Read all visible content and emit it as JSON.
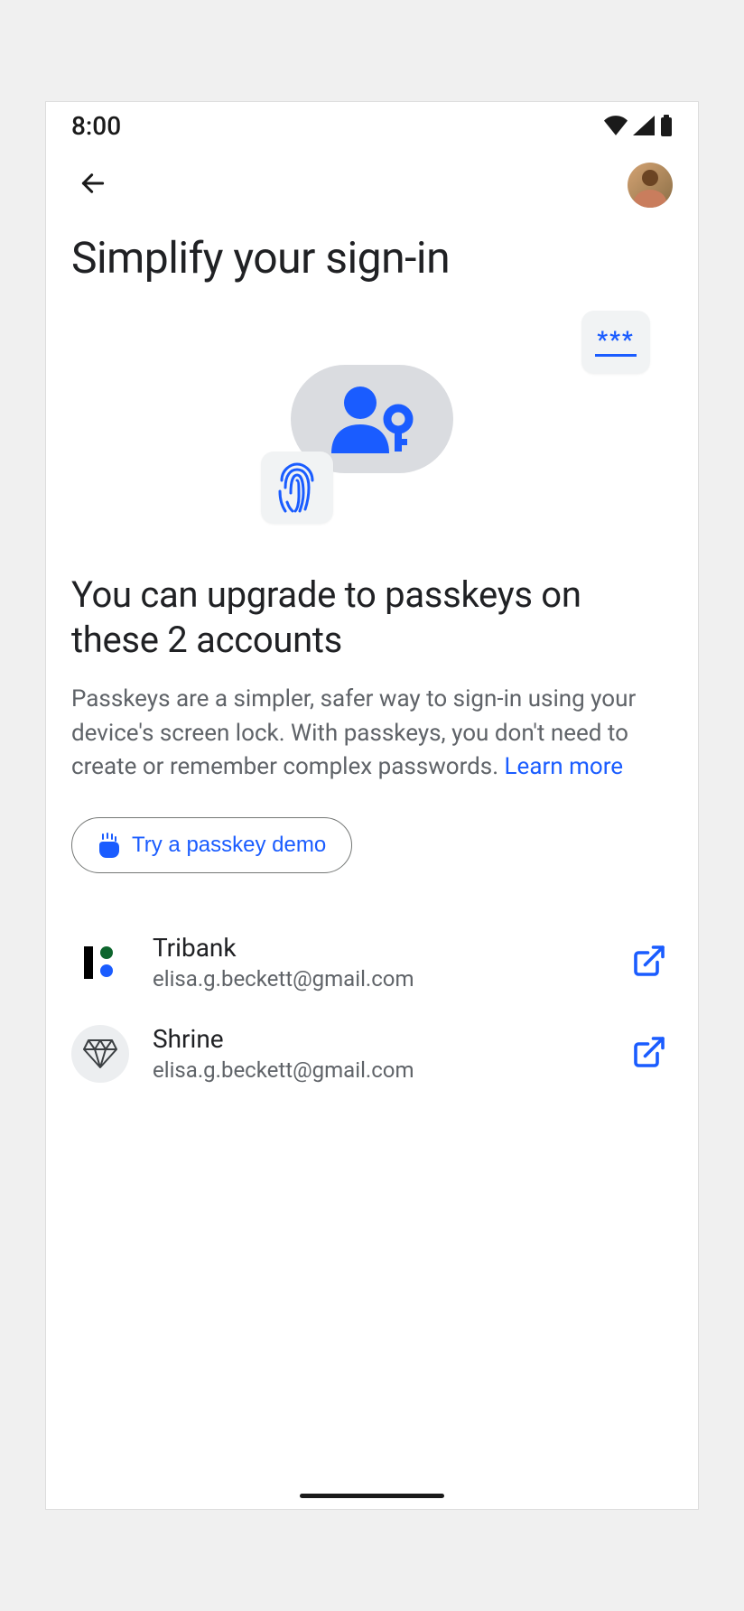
{
  "status": {
    "time": "8:00"
  },
  "page": {
    "title": "Simplify your sign-in"
  },
  "section": {
    "heading": "You can upgrade to passkeys on these 2 accounts",
    "body": "Passkeys are a simpler, safer way to sign-in using your device's screen lock. With passkeys, you don't need to create or remember complex passwords. ",
    "learn_more": "Learn more"
  },
  "demo_button": {
    "label": "Try a passkey demo"
  },
  "accounts": [
    {
      "name": "Tribank",
      "email": "elisa.g.beckett@gmail.com",
      "icon": "tribank"
    },
    {
      "name": "Shrine",
      "email": "elisa.g.beckett@gmail.com",
      "icon": "shrine"
    }
  ],
  "colors": {
    "accent": "#1a5cff"
  }
}
